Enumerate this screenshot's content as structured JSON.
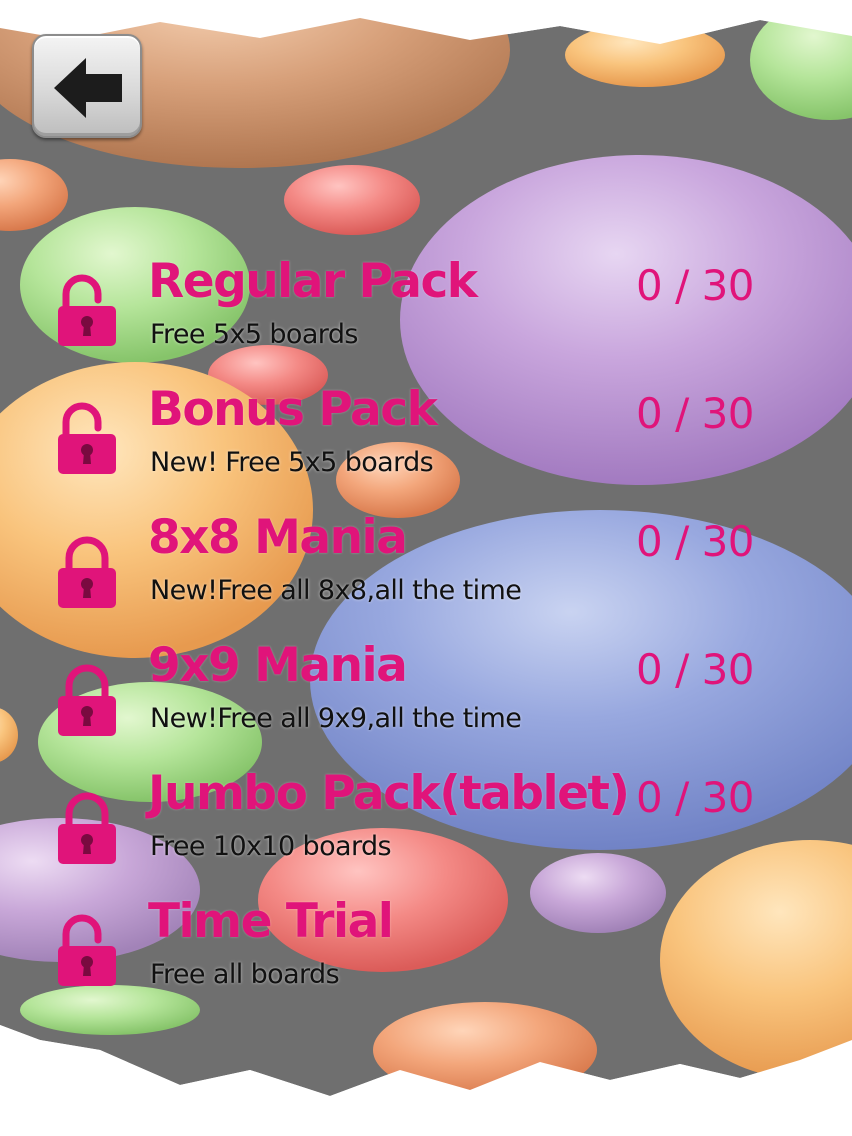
{
  "colors": {
    "accent": "#e0147a",
    "subtitle": "#111111",
    "background_gray": "#707070",
    "lock": "#e0147a"
  },
  "back_button": {
    "icon": "arrow-left-icon"
  },
  "packs": [
    {
      "title": "Regular Pack",
      "subtitle": "Free 5x5 boards",
      "progress": "0 / 30",
      "icon": "unlocked-padlock-icon"
    },
    {
      "title": "Bonus Pack",
      "subtitle": "New! Free 5x5 boards",
      "progress": "0 / 30",
      "icon": "unlocked-padlock-icon"
    },
    {
      "title": "8x8 Mania",
      "subtitle": "New!Free all 8x8,all the time",
      "progress": "0 / 30",
      "icon": "locked-padlock-icon"
    },
    {
      "title": "9x9 Mania",
      "subtitle": "New!Free all 9x9,all the time",
      "progress": "0 / 30",
      "icon": "locked-padlock-icon"
    },
    {
      "title": "Jumbo Pack(tablet)",
      "subtitle": "Free 10x10 boards",
      "progress": "0 / 30",
      "icon": "locked-padlock-icon"
    },
    {
      "title": "Time Trial",
      "subtitle": "Free all boards",
      "progress": "",
      "icon": "unlocked-padlock-icon"
    }
  ]
}
